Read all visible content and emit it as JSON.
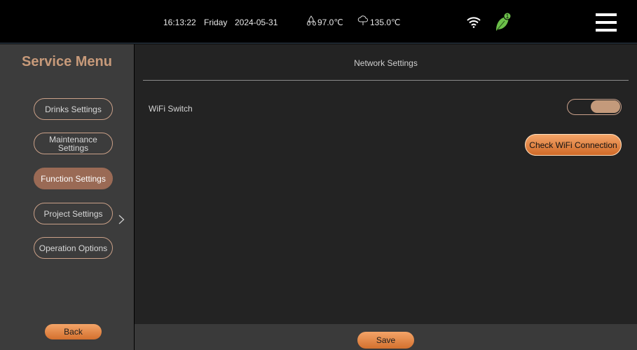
{
  "status_bar": {
    "time": "16:13:22",
    "day": "Friday",
    "date": "2024-05-31",
    "water_temp": "97.0℃",
    "steam_temp": "135.0℃",
    "icons": [
      "water-drops-icon",
      "steam-icon",
      "wifi-icon",
      "leaf-icon",
      "menu-icon"
    ],
    "leaf_badge": "1"
  },
  "sidebar": {
    "title": "Service Menu",
    "items": [
      {
        "label": "Drinks Settings",
        "active": false
      },
      {
        "label": "Maintenance Settings",
        "active": false
      },
      {
        "label": "Function Settings",
        "active": true
      },
      {
        "label": "Project Settings",
        "active": false
      },
      {
        "label": "Operation Options",
        "active": false
      }
    ],
    "back_label": "Back"
  },
  "main": {
    "title": "Network Settings",
    "wifi_switch": {
      "label": "WiFi Switch",
      "on": true
    },
    "check_wifi_label": "Check WiFi Connection"
  },
  "footer": {
    "save_label": "Save"
  },
  "colors": {
    "accent_orange": "#e0843f",
    "active_item": "#9a6a55",
    "title_text": "#c79a7a",
    "leaf_green": "#6cc04a"
  }
}
